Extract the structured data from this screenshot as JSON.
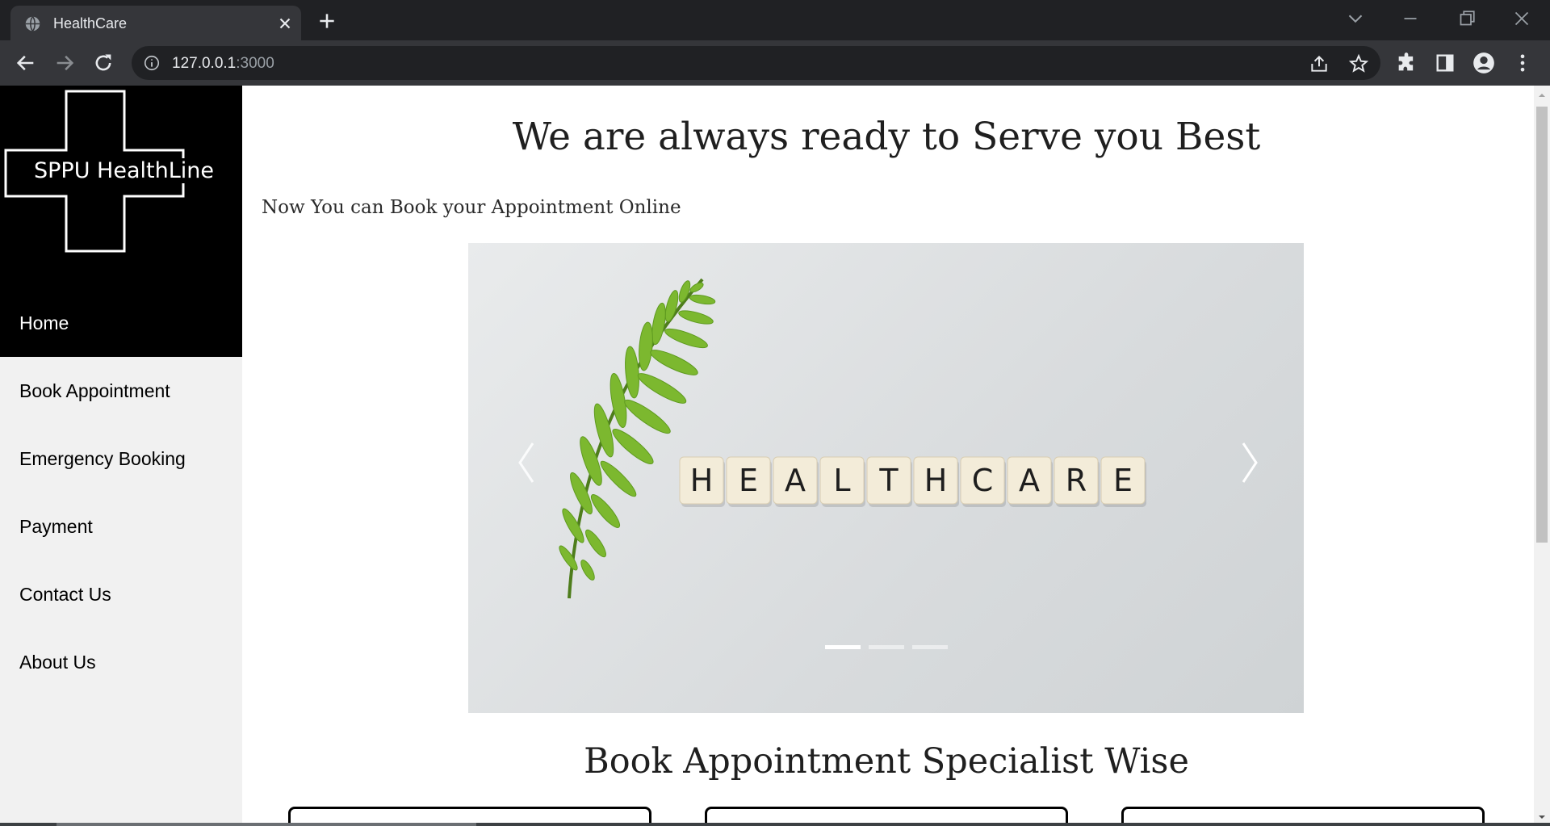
{
  "browser": {
    "tab_title": "HealthCare",
    "url_host": "127.0.0.1",
    "url_port": ":3000"
  },
  "sidebar": {
    "logo_text": "SPPU HealthLine",
    "items": [
      {
        "label": "Home",
        "active": true
      },
      {
        "label": "Book Appointment",
        "active": false
      },
      {
        "label": "Emergency Booking",
        "active": false
      },
      {
        "label": "Payment",
        "active": false
      },
      {
        "label": "Contact Us",
        "active": false
      },
      {
        "label": "About Us",
        "active": false
      }
    ]
  },
  "main": {
    "hero_title": "We are always ready to Serve you Best",
    "sub_title": "Now You can Book your Appointment Online",
    "carousel": {
      "tiles": [
        "H",
        "E",
        "A",
        "L",
        "T",
        "H",
        "C",
        "A",
        "R",
        "E"
      ],
      "slide_count": 3,
      "active_slide": 0
    },
    "specialist_title": "Book Appointment Specialist Wise"
  },
  "colors": {
    "sidebar_bg": "#f1f1f1",
    "active_bg": "#000000",
    "chrome_dark": "#202124",
    "chrome_toolbar": "#35363a"
  }
}
